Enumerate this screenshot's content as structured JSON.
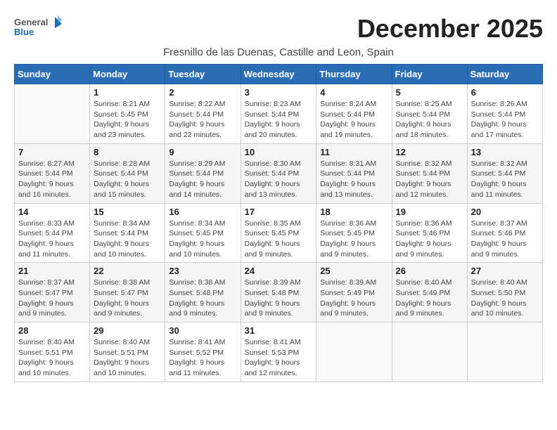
{
  "header": {
    "logo_general": "General",
    "logo_blue": "Blue",
    "month_title": "December 2025",
    "location": "Fresnillo de las Duenas, Castille and Leon, Spain"
  },
  "weekdays": [
    "Sunday",
    "Monday",
    "Tuesday",
    "Wednesday",
    "Thursday",
    "Friday",
    "Saturday"
  ],
  "weeks": [
    [
      {
        "day": "",
        "info": ""
      },
      {
        "day": "1",
        "info": "Sunrise: 8:21 AM\nSunset: 5:45 PM\nDaylight: 9 hours\nand 23 minutes."
      },
      {
        "day": "2",
        "info": "Sunrise: 8:22 AM\nSunset: 5:44 PM\nDaylight: 9 hours\nand 22 minutes."
      },
      {
        "day": "3",
        "info": "Sunrise: 8:23 AM\nSunset: 5:44 PM\nDaylight: 9 hours\nand 20 minutes."
      },
      {
        "day": "4",
        "info": "Sunrise: 8:24 AM\nSunset: 5:44 PM\nDaylight: 9 hours\nand 19 minutes."
      },
      {
        "day": "5",
        "info": "Sunrise: 8:25 AM\nSunset: 5:44 PM\nDaylight: 9 hours\nand 18 minutes."
      },
      {
        "day": "6",
        "info": "Sunrise: 8:26 AM\nSunset: 5:44 PM\nDaylight: 9 hours\nand 17 minutes."
      }
    ],
    [
      {
        "day": "7",
        "info": "Sunrise: 8:27 AM\nSunset: 5:44 PM\nDaylight: 9 hours\nand 16 minutes."
      },
      {
        "day": "8",
        "info": "Sunrise: 8:28 AM\nSunset: 5:44 PM\nDaylight: 9 hours\nand 15 minutes."
      },
      {
        "day": "9",
        "info": "Sunrise: 8:29 AM\nSunset: 5:44 PM\nDaylight: 9 hours\nand 14 minutes."
      },
      {
        "day": "10",
        "info": "Sunrise: 8:30 AM\nSunset: 5:44 PM\nDaylight: 9 hours\nand 13 minutes."
      },
      {
        "day": "11",
        "info": "Sunrise: 8:31 AM\nSunset: 5:44 PM\nDaylight: 9 hours\nand 13 minutes."
      },
      {
        "day": "12",
        "info": "Sunrise: 8:32 AM\nSunset: 5:44 PM\nDaylight: 9 hours\nand 12 minutes."
      },
      {
        "day": "13",
        "info": "Sunrise: 8:32 AM\nSunset: 5:44 PM\nDaylight: 9 hours\nand 11 minutes."
      }
    ],
    [
      {
        "day": "14",
        "info": "Sunrise: 8:33 AM\nSunset: 5:44 PM\nDaylight: 9 hours\nand 11 minutes."
      },
      {
        "day": "15",
        "info": "Sunrise: 8:34 AM\nSunset: 5:44 PM\nDaylight: 9 hours\nand 10 minutes."
      },
      {
        "day": "16",
        "info": "Sunrise: 8:34 AM\nSunset: 5:45 PM\nDaylight: 9 hours\nand 10 minutes."
      },
      {
        "day": "17",
        "info": "Sunrise: 8:35 AM\nSunset: 5:45 PM\nDaylight: 9 hours\nand 9 minutes."
      },
      {
        "day": "18",
        "info": "Sunrise: 8:36 AM\nSunset: 5:45 PM\nDaylight: 9 hours\nand 9 minutes."
      },
      {
        "day": "19",
        "info": "Sunrise: 8:36 AM\nSunset: 5:46 PM\nDaylight: 9 hours\nand 9 minutes."
      },
      {
        "day": "20",
        "info": "Sunrise: 8:37 AM\nSunset: 5:46 PM\nDaylight: 9 hours\nand 9 minutes."
      }
    ],
    [
      {
        "day": "21",
        "info": "Sunrise: 8:37 AM\nSunset: 5:47 PM\nDaylight: 9 hours\nand 9 minutes."
      },
      {
        "day": "22",
        "info": "Sunrise: 8:38 AM\nSunset: 5:47 PM\nDaylight: 9 hours\nand 9 minutes."
      },
      {
        "day": "23",
        "info": "Sunrise: 8:38 AM\nSunset: 5:48 PM\nDaylight: 9 hours\nand 9 minutes."
      },
      {
        "day": "24",
        "info": "Sunrise: 8:39 AM\nSunset: 5:48 PM\nDaylight: 9 hours\nand 9 minutes."
      },
      {
        "day": "25",
        "info": "Sunrise: 8:39 AM\nSunset: 5:49 PM\nDaylight: 9 hours\nand 9 minutes."
      },
      {
        "day": "26",
        "info": "Sunrise: 8:40 AM\nSunset: 5:49 PM\nDaylight: 9 hours\nand 9 minutes."
      },
      {
        "day": "27",
        "info": "Sunrise: 8:40 AM\nSunset: 5:50 PM\nDaylight: 9 hours\nand 10 minutes."
      }
    ],
    [
      {
        "day": "28",
        "info": "Sunrise: 8:40 AM\nSunset: 5:51 PM\nDaylight: 9 hours\nand 10 minutes."
      },
      {
        "day": "29",
        "info": "Sunrise: 8:40 AM\nSunset: 5:51 PM\nDaylight: 9 hours\nand 10 minutes."
      },
      {
        "day": "30",
        "info": "Sunrise: 8:41 AM\nSunset: 5:52 PM\nDaylight: 9 hours\nand 11 minutes."
      },
      {
        "day": "31",
        "info": "Sunrise: 8:41 AM\nSunset: 5:53 PM\nDaylight: 9 hours\nand 12 minutes."
      },
      {
        "day": "",
        "info": ""
      },
      {
        "day": "",
        "info": ""
      },
      {
        "day": "",
        "info": ""
      }
    ]
  ]
}
